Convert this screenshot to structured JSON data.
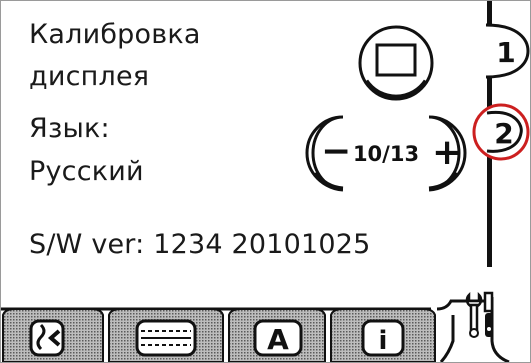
{
  "settings": {
    "calibration_line1": "Калибровка",
    "calibration_line2": "дисплея",
    "language_label": "Язык:",
    "language_value": "Русский",
    "language_index": "10/13",
    "software_version": "S/W ver: 1234 20101025"
  },
  "stepper": {
    "minus": "−",
    "plus": "+"
  },
  "pages": {
    "page1": "1",
    "page2": "2"
  },
  "tabs": [
    {
      "icon": "stitch-selection-icon"
    },
    {
      "icon": "stitch-sequence-icon"
    },
    {
      "icon": "font-icon",
      "label": "A"
    },
    {
      "icon": "info-icon",
      "label": "i"
    },
    {
      "icon": "tools-icon"
    }
  ],
  "colors": {
    "highlight_circle": "#cc1f1f",
    "tab_fill": "#7a7a7a"
  }
}
